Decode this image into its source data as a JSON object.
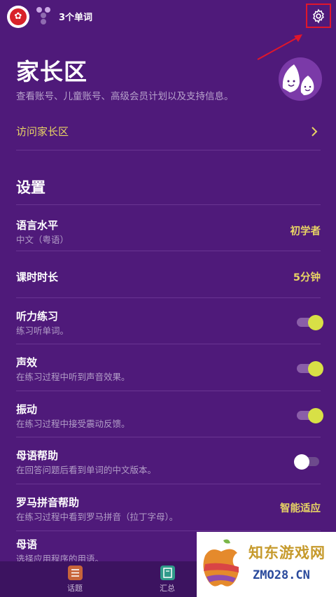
{
  "header": {
    "word_count": "3个单词",
    "flag_glyph": "✿"
  },
  "hero": {
    "title": "家长区",
    "subtitle": "查看账号、儿童账号、高级会员计划以及支持信息。",
    "parent_link": "访问家长区"
  },
  "settings": {
    "heading": "设置",
    "items": [
      {
        "title": "语言水平",
        "subtitle": "中文（粤语）",
        "value": "初学者"
      },
      {
        "title": "课时时长",
        "value": "5分钟"
      },
      {
        "title": "听力练习",
        "subtitle": "练习听单词。",
        "toggle": true
      },
      {
        "title": "声效",
        "subtitle": "在练习过程中听到声音效果。",
        "toggle": true
      },
      {
        "title": "振动",
        "subtitle": "在练习过程中接受震动反馈。",
        "toggle": true
      },
      {
        "title": "母语帮助",
        "subtitle": "在回答问题后看到单词的中文版本。",
        "toggle": false
      },
      {
        "title": "罗马拼音帮助",
        "subtitle": "在练习过程中看到罗马拼音（拉丁字母）。",
        "value": "智能适应"
      },
      {
        "title": "母语",
        "subtitle": "选择应用程序的用语。"
      }
    ]
  },
  "bottom_nav": {
    "tabs": [
      {
        "label": "话题"
      },
      {
        "label": "汇总"
      }
    ]
  },
  "watermark": {
    "text": "知东游戏网",
    "url": "ZMO28.CN"
  },
  "colors": {
    "background": "#4f1a7a",
    "accent_yellow": "#e8d464",
    "toggle_on": "#d8e046",
    "highlight_box": "#e0162b"
  }
}
